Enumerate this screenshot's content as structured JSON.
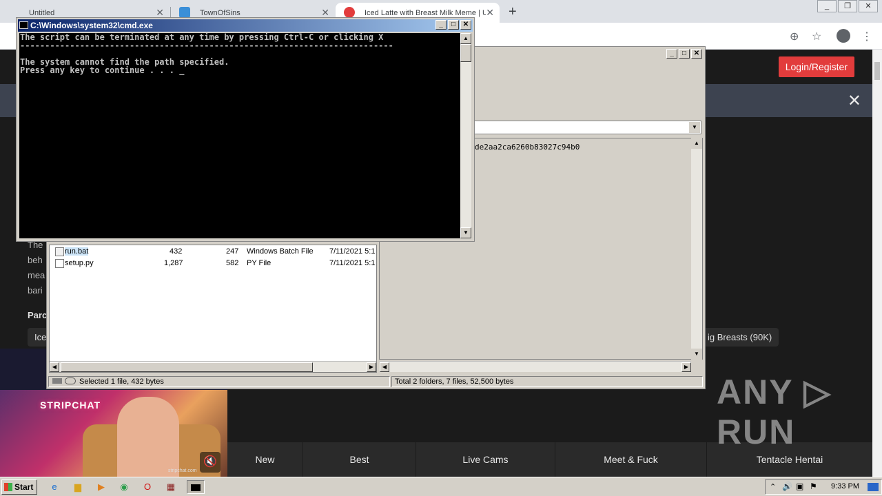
{
  "browser": {
    "tabs": [
      {
        "title": "Untitled"
      },
      {
        "title": "TownOfSins"
      },
      {
        "title": "Iced Latte with Breast Milk Meme | U"
      }
    ],
    "close_glyph": "✕",
    "new_tab_glyph": "+"
  },
  "site": {
    "login_label": "Login/Register",
    "body_fragments": [
      "The",
      "beh",
      "mea",
      "bari"
    ],
    "section_label": "Parc",
    "tag_left": "Ice",
    "tag_right": "ig Breasts (90K)",
    "bottom_nav": [
      "New",
      "Best",
      "Live Cams",
      "Meet & Fuck",
      "Tentacle Hentai"
    ],
    "promo_brand": "STRIPCHAT",
    "promo_watermark": "stripchat.com"
  },
  "explorer": {
    "hash": "de2aa2ca6260b83027c94b0",
    "files": [
      {
        "name": "run.bat",
        "size": "432",
        "packed": "247",
        "type": "Windows Batch File",
        "modified": "7/11/2021 5:1"
      },
      {
        "name": "setup.py",
        "size": "1,287",
        "packed": "582",
        "type": "PY File",
        "modified": "7/11/2021 5:1"
      }
    ],
    "status_left": "Selected 1 file, 432 bytes",
    "status_right": "Total 2 folders, 7 files, 52,500 bytes"
  },
  "cmd": {
    "title": "C:\\Windows\\system32\\cmd.exe",
    "lines": [
      "The script can be terminated at any time by pressing Ctrl-C or clicking X",
      "---------------------------------------------------------------------------",
      "The system cannot find the path specified.",
      "Press any key to continue . . . _"
    ]
  },
  "taskbar": {
    "start_label": "Start",
    "clock": "9:33 PM"
  },
  "watermark": "ANY ▷ RUN",
  "colors": {
    "accent_red": "#e23c3c",
    "titlebar_active": "#0a246a"
  }
}
